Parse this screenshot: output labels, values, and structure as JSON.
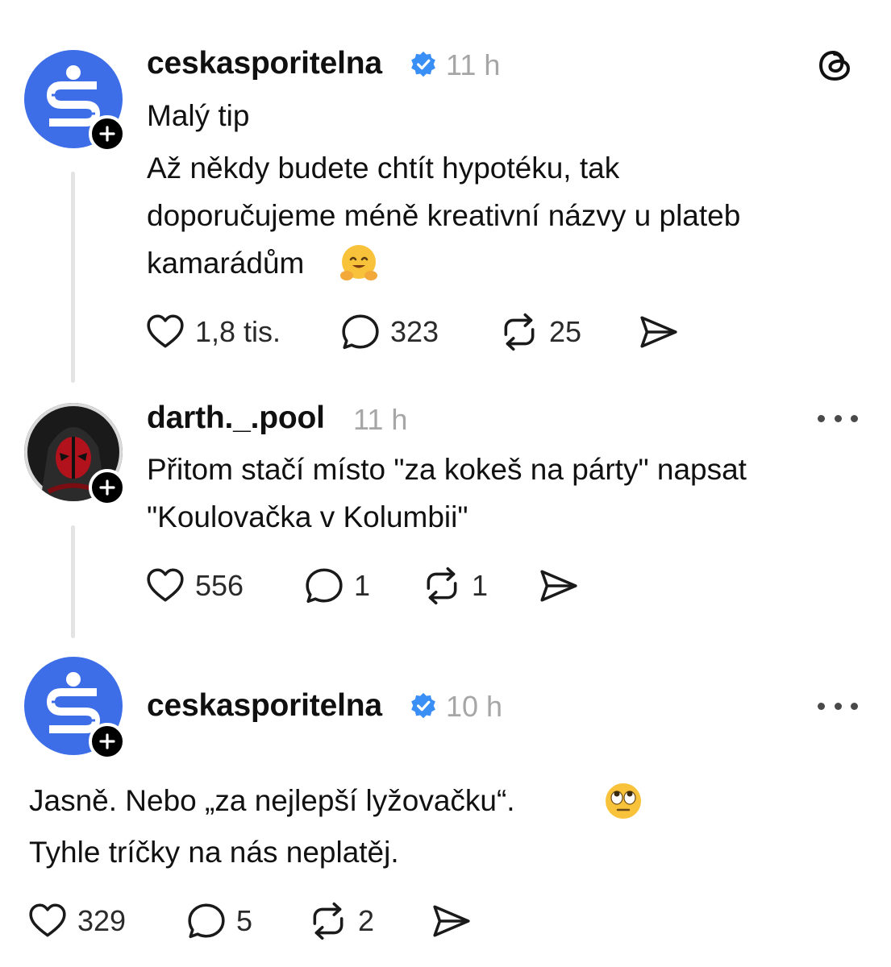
{
  "colors": {
    "verified": "#3a8ff7",
    "brand_avatar_bg": "#3d6ee8",
    "time_gray": "#a6a6a6"
  },
  "app_icon": "threads-logo-icon",
  "posts": [
    {
      "author": "ceskasporitelna",
      "verified": true,
      "time": "11 h",
      "lines": [
        "Malý tip",
        "Až někdy budete chtít hypotéku, tak",
        "doporučujeme méně kreativní názvy u plateb",
        "kamarádům"
      ],
      "emoji": "hugging-face-emoji",
      "likes": "1,8 tis.",
      "replies": "323",
      "reposts": "25"
    },
    {
      "author": "darth._.pool",
      "verified": false,
      "time": "11 h",
      "lines": [
        "Přitom stačí místo \"za kokeš na párty\" napsat",
        "\"Koulovačka v Kolumbii\""
      ],
      "likes": "556",
      "replies": "1",
      "reposts": "1"
    },
    {
      "author": "ceskasporitelna",
      "verified": true,
      "time": "10 h",
      "lines": [
        "Jasně. Nebo „za nejlepší lyžovačku“.",
        "Tyhle tríčky na nás neplatěj."
      ],
      "emoji": "eye-roll-emoji",
      "likes": "329",
      "replies": "5",
      "reposts": "2"
    }
  ]
}
